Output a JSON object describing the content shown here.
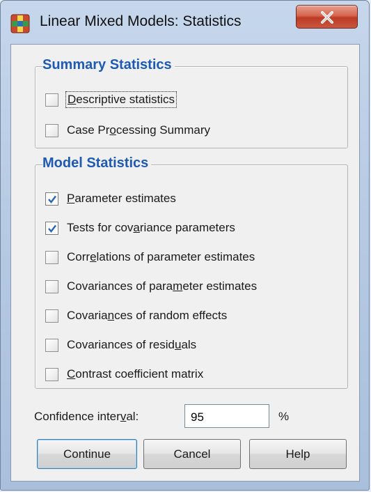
{
  "window": {
    "title": "Linear Mixed Models: Statistics"
  },
  "summary_statistics": {
    "legend": "Summary Statistics",
    "items": [
      {
        "label_pre": "",
        "label_ul": "D",
        "label_post": "escriptive statistics",
        "checked": false
      },
      {
        "label_pre": "Case Pr",
        "label_ul": "o",
        "label_post": "cessing Summary",
        "checked": false
      }
    ]
  },
  "model_statistics": {
    "legend": "Model Statistics",
    "items": [
      {
        "label_pre": "",
        "label_ul": "P",
        "label_post": "arameter estimates",
        "checked": true
      },
      {
        "label_pre": "Tests for cov",
        "label_ul": "a",
        "label_post": "riance parameters",
        "checked": true
      },
      {
        "label_pre": "Corr",
        "label_ul": "e",
        "label_post": "lations of parameter estimates",
        "checked": false
      },
      {
        "label_pre": "Covariances of para",
        "label_ul": "m",
        "label_post": "eter estimates",
        "checked": false
      },
      {
        "label_pre": "Covaria",
        "label_ul": "n",
        "label_post": "ces of random effects",
        "checked": false
      },
      {
        "label_pre": "Covariances of resid",
        "label_ul": "u",
        "label_post": "als",
        "checked": false
      },
      {
        "label_pre": "",
        "label_ul": "C",
        "label_post": "ontrast coefficient matrix",
        "checked": false
      }
    ]
  },
  "confidence_interval": {
    "label_pre": "Confidence inter",
    "label_ul": "v",
    "label_post": "al:",
    "value": "95",
    "unit": "%"
  },
  "buttons": {
    "continue": "Continue",
    "cancel": "Cancel",
    "help": "Help"
  },
  "colors": {
    "legend_text": "#1e5ab4",
    "checkmark": "#2a62b5",
    "close_button": "#c9573f"
  },
  "icons": {
    "app": "spss-dialog-icon",
    "close": "close-icon",
    "check": "checkmark-icon"
  }
}
